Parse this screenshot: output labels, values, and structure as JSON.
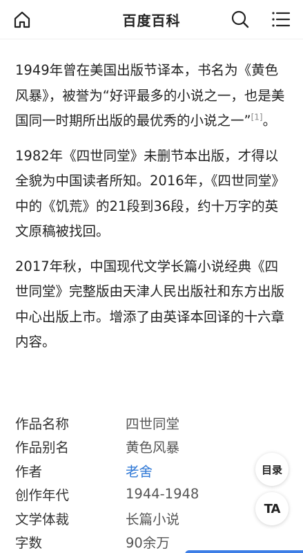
{
  "header": {
    "title": "百度百科"
  },
  "paragraphs": [
    {
      "text": "1949年曾在美国出版节译本，书名为《黄色风暴》，被誉为“好评最多的小说之一，也是美国同一时期所出版的最优秀的小说之一”",
      "ref": "[1]",
      "tail": "。"
    },
    {
      "text": "1982年《四世同堂》未删节本出版，才得以全貌为中国读者所知。2016年，《四世同堂》中的《饥荒》的21段到36段，约十万字的英文原稿被找回。"
    },
    {
      "text": "2017年秋，中国现代文学长篇小说经典《四世同堂》完整版由天津人民出版社和东方出版中心出版上市。增添了由英译本回译的十六章内容。"
    }
  ],
  "info": [
    {
      "key": "作品名称",
      "value": "四世同堂"
    },
    {
      "key": "作品别名",
      "value": "黄色风暴"
    },
    {
      "key": "作者",
      "value": "老舍"
    },
    {
      "key": "创作年代",
      "value": "1944-1948"
    },
    {
      "key": "文学体裁",
      "value": "长篇小说"
    },
    {
      "key": "字数",
      "value": "90余万"
    }
  ],
  "floating": {
    "toc_label": "目录",
    "ta_label": "TA"
  },
  "colors": {
    "link": "#2f78d6",
    "accent_bar": "#3d7ee6"
  }
}
